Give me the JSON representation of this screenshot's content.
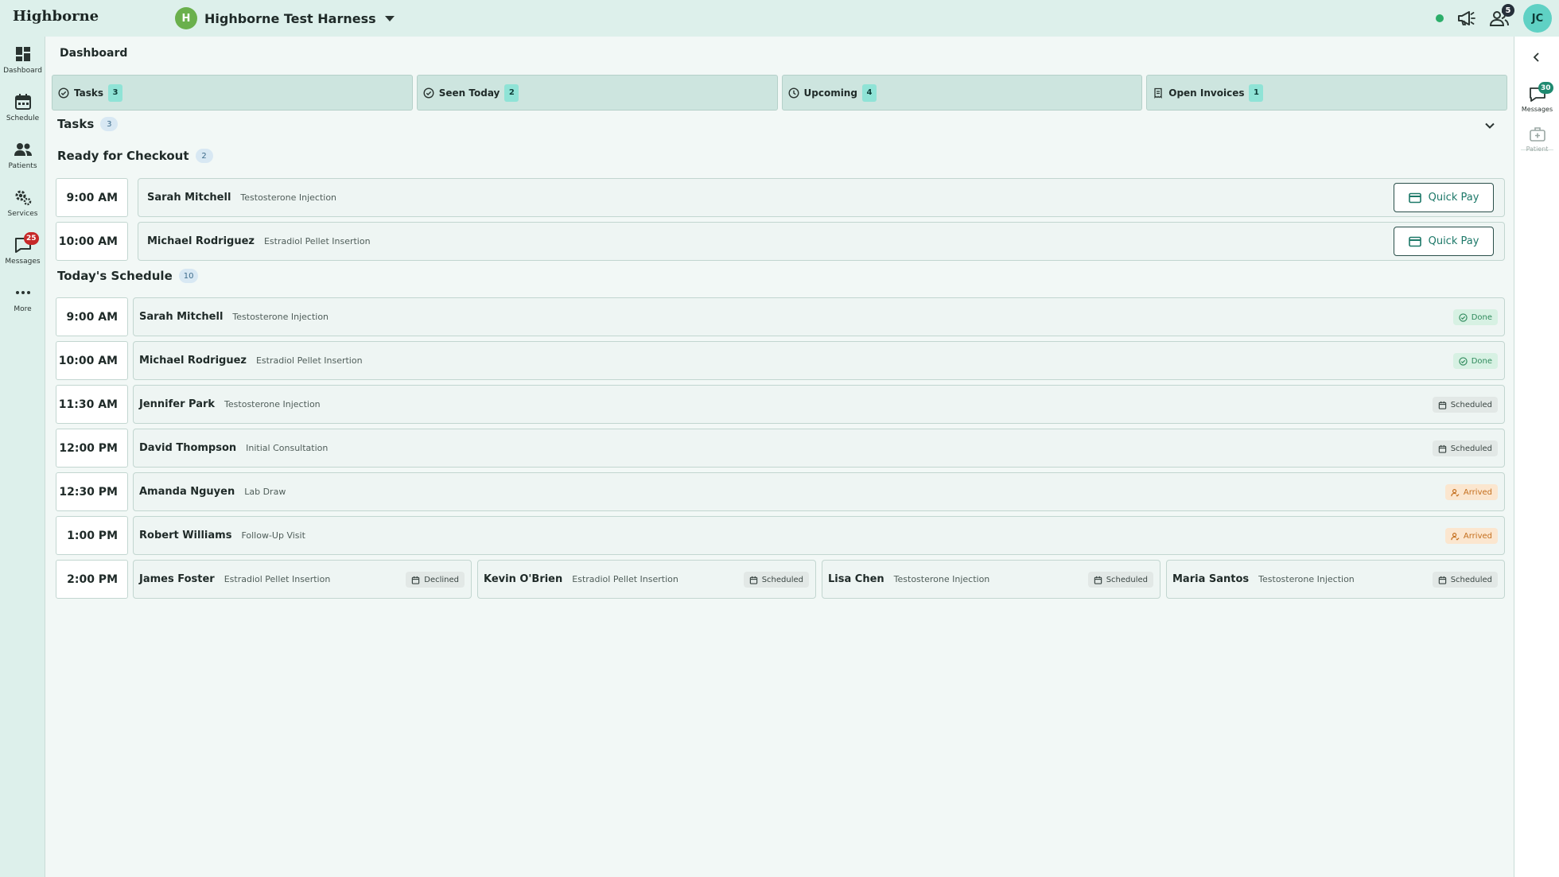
{
  "app": {
    "brand": "Highborne",
    "org_initial": "H",
    "org_name": "Highborne Test Harness",
    "user_initials": "JC",
    "announcements_icon": "megaphone-icon",
    "people_badge": "5",
    "online_status_color": "#2cae6a"
  },
  "leftnav": {
    "items": [
      {
        "label": "Dashboard",
        "icon": "dashboard-icon"
      },
      {
        "label": "Schedule",
        "icon": "calendar-icon"
      },
      {
        "label": "Patients",
        "icon": "people-icon"
      },
      {
        "label": "Services",
        "icon": "gears-icon"
      },
      {
        "label": "Messages",
        "icon": "chat-icon",
        "badge": "25"
      },
      {
        "label": "More",
        "icon": "more-icon"
      }
    ]
  },
  "rightrail": {
    "messages_label": "Messages",
    "messages_badge": "30",
    "patient_label": "Patient"
  },
  "page": {
    "title": "Dashboard"
  },
  "tabs": [
    {
      "label": "Tasks",
      "count": "3",
      "icon": "check-circle-icon"
    },
    {
      "label": "Seen Today",
      "count": "2",
      "icon": "check-circle-icon"
    },
    {
      "label": "Upcoming",
      "count": "4",
      "icon": "clock-icon"
    },
    {
      "label": "Open Invoices",
      "count": "1",
      "icon": "receipt-icon"
    }
  ],
  "tasks": {
    "title": "Tasks",
    "count": "3"
  },
  "checkout": {
    "title": "Ready for Checkout",
    "count": "2",
    "button_label": "Quick Pay",
    "rows": [
      {
        "time": "9:00 AM",
        "name": "Sarah Mitchell",
        "service": "Testosterone Injection"
      },
      {
        "time": "10:00 AM",
        "name": "Michael Rodriguez",
        "service": "Estradiol Pellet Insertion"
      }
    ]
  },
  "schedule": {
    "title": "Today's Schedule",
    "count": "10",
    "rows": [
      {
        "time": "9:00 AM",
        "appts": [
          {
            "name": "Sarah Mitchell",
            "service": "Testosterone Injection",
            "status": "Done"
          }
        ]
      },
      {
        "time": "10:00 AM",
        "appts": [
          {
            "name": "Michael Rodriguez",
            "service": "Estradiol Pellet Insertion",
            "status": "Done"
          }
        ]
      },
      {
        "time": "11:30 AM",
        "appts": [
          {
            "name": "Jennifer Park",
            "service": "Testosterone Injection",
            "status": "Scheduled"
          }
        ]
      },
      {
        "time": "12:00 PM",
        "appts": [
          {
            "name": "David Thompson",
            "service": "Initial Consultation",
            "status": "Scheduled"
          }
        ]
      },
      {
        "time": "12:30 PM",
        "appts": [
          {
            "name": "Amanda Nguyen",
            "service": "Lab Draw",
            "status": "Arrived"
          }
        ]
      },
      {
        "time": "1:00 PM",
        "appts": [
          {
            "name": "Robert Williams",
            "service": "Follow-Up Visit",
            "status": "Arrived"
          }
        ]
      },
      {
        "time": "2:00 PM",
        "appts": [
          {
            "name": "James Foster",
            "service": "Estradiol Pellet Insertion",
            "status": "Declined"
          },
          {
            "name": "Kevin O'Brien",
            "service": "Estradiol Pellet Insertion",
            "status": "Scheduled"
          },
          {
            "name": "Lisa Chen",
            "service": "Testosterone Injection",
            "status": "Scheduled"
          },
          {
            "name": "Maria Santos",
            "service": "Testosterone Injection",
            "status": "Scheduled"
          }
        ]
      }
    ]
  },
  "colors": {
    "accent": "#1c7868",
    "done": "#2f8a5c",
    "arrived": "#c46f1e",
    "nav_badge": "#c62828"
  }
}
